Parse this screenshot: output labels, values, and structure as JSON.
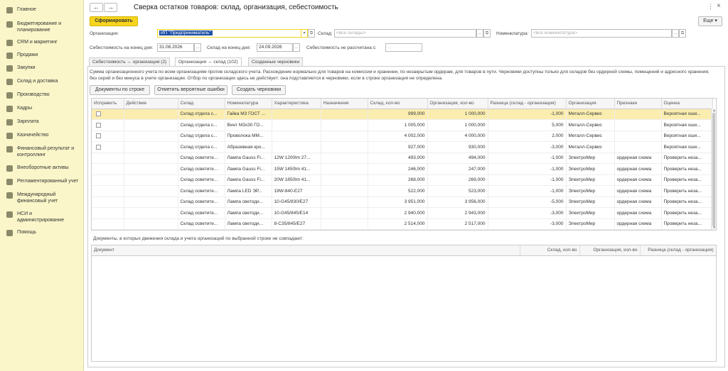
{
  "sidebar": {
    "items": [
      {
        "label": "Главное",
        "icon": "home-icon"
      },
      {
        "label": "Бюджетирование и планирование",
        "icon": "budget-icon"
      },
      {
        "label": "CRM и маркетинг",
        "icon": "crm-icon"
      },
      {
        "label": "Продажи",
        "icon": "sales-icon"
      },
      {
        "label": "Закупки",
        "icon": "purchases-icon"
      },
      {
        "label": "Склад и доставка",
        "icon": "warehouse-icon"
      },
      {
        "label": "Производство",
        "icon": "production-icon"
      },
      {
        "label": "Кадры",
        "icon": "staff-icon"
      },
      {
        "label": "Зарплата",
        "icon": "salary-icon"
      },
      {
        "label": "Казначейство",
        "icon": "treasury-icon"
      },
      {
        "label": "Финансовый результат и контроллинг",
        "icon": "finance-icon"
      },
      {
        "label": "Внеоборотные активы",
        "icon": "assets-icon"
      },
      {
        "label": "Регламентированный учет",
        "icon": "accounting-icon"
      },
      {
        "label": "Международный финансовый учет",
        "icon": "intl-icon"
      },
      {
        "label": "НСИ и администрирование",
        "icon": "admin-icon"
      },
      {
        "label": "Помощь",
        "icon": "help-icon"
      }
    ]
  },
  "header": {
    "back": "←",
    "forward": "→",
    "title": "Сверка остатков товаров: склад, организация, себестоимость",
    "more_menu": "⋮",
    "close": "×"
  },
  "toolbar": {
    "generate": "Сформировать",
    "more": "Еще ▾"
  },
  "filters": {
    "org_label": "Организация:",
    "org_value": "ИП \"Предприниматель\"",
    "warehouse_label": "Склад:",
    "warehouse_placeholder": "<все склады>",
    "nomenclature_label": "Номенклатура:",
    "nomenclature_placeholder": "<вся номенклатура>",
    "cost_end_label": "Себестоимость на конец дня:",
    "cost_end_value": "31.08.2026",
    "wh_end_label": "Склад на конец дня:",
    "wh_end_value": "24.09.2026",
    "cost_not_calc_label": "Себестоимость не рассчитана с:",
    "cost_not_calc_value": ". .",
    "drop": "...",
    "open": "⧉",
    "drop2": "▾"
  },
  "tabs": [
    {
      "label": "Себестоимость ↔ организация (2)"
    },
    {
      "label": "Организация ↔ склад (102)"
    },
    {
      "label": "Созданные черновики"
    }
  ],
  "description": "Сумма организационного учета по всем организациям против складского учета. Расхождение нормально для товаров на комиссии и хранении, по незакрытым ордерам, для товаров в пути. Черновики доступны только для складов без ордерной схемы, помещений и адресного хранения; без серий и без минуса в учете организации. Отбор по организации здесь не действует: она подставляется в черновики, если в строке организация не определена.",
  "actions": {
    "docs_by_row": "Документы по строке",
    "mark_errors": "Отметить вероятные ошибки",
    "create_drafts": "Создать черновики"
  },
  "grid": {
    "columns": [
      "Исправить",
      "Действие",
      "Склад",
      "Номенклатура",
      "Характеристика",
      "Назначение",
      "Склад, кол-во",
      "Организация, кол-во",
      "Разница (склад - организация)",
      "Организация",
      "Признаки",
      "Оценка"
    ],
    "rows": [
      {
        "check": true,
        "action": "",
        "wh": "Склад отдела с...",
        "nom": "Гайка М3 ГОСТ ...",
        "char": "",
        "purpose": "",
        "whq": "999,000",
        "orgq": "1 000,000",
        "diff": "-1,000",
        "org": "Металл-Сервис",
        "sign": "",
        "eval": "Вероятная оши..."
      },
      {
        "check": true,
        "action": "",
        "wh": "Склад отдела с...",
        "nom": "Винт М3х30 ГО...",
        "char": "",
        "purpose": "",
        "whq": "1 005,000",
        "orgq": "1 000,000",
        "diff": "5,000",
        "org": "Металл-Сервис",
        "sign": "",
        "eval": "Вероятная оши..."
      },
      {
        "check": true,
        "action": "",
        "wh": "Склад отдела с...",
        "nom": "Проволока  ММ...",
        "char": "",
        "purpose": "",
        "whq": "4 002,000",
        "orgq": "4 000,000",
        "diff": "2,000",
        "org": "Металл-Сервис",
        "sign": "",
        "eval": "Вероятная оши..."
      },
      {
        "check": true,
        "action": "",
        "wh": "Склад отдела с...",
        "nom": "Абразивная кро...",
        "char": "",
        "purpose": "",
        "whq": "927,000",
        "orgq": "930,000",
        "diff": "-3,000",
        "org": "Металл-Сервис",
        "sign": "",
        "eval": "Вероятная оши..."
      },
      {
        "check": false,
        "action": "",
        "wh": "Склад осветите...",
        "nom": "Лампа Gauss Fi...",
        "char": "12W 1200lm 27...",
        "purpose": "",
        "whq": "493,000",
        "orgq": "494,000",
        "diff": "-1,000",
        "org": "ЭлектроМир",
        "sign": "ордерная схема",
        "eval": "Проверить неза..."
      },
      {
        "check": false,
        "action": "",
        "wh": "Склад осветите...",
        "nom": "Лампа Gauss Fi...",
        "char": "15W 1450lm 41...",
        "purpose": "",
        "whq": "246,000",
        "orgq": "247,000",
        "diff": "-1,000",
        "org": "ЭлектроМир",
        "sign": "ордерная схема",
        "eval": "Проверить неза..."
      },
      {
        "check": false,
        "action": "",
        "wh": "Склад осветите...",
        "nom": "Лампа Gauss Fi...",
        "char": "20W 1850lm 41...",
        "purpose": "",
        "whq": "268,000",
        "orgq": "269,000",
        "diff": "-1,000",
        "org": "ЭлектроМир",
        "sign": "ордерная схема",
        "eval": "Проверить неза..."
      },
      {
        "check": false,
        "action": "",
        "wh": "Склад осветите...",
        "nom": "Лампа LED ЭР...",
        "char": "19W-840-E27",
        "purpose": "",
        "whq": "522,000",
        "orgq": "523,000",
        "diff": "-1,000",
        "org": "ЭлектроМир",
        "sign": "ордерная схема",
        "eval": "Проверить неза..."
      },
      {
        "check": false,
        "action": "",
        "wh": "Склад осветите...",
        "nom": "Лампа светоди...",
        "char": "10-G45/830/E27",
        "purpose": "",
        "whq": "3 951,000",
        "orgq": "3 956,000",
        "diff": "-5,000",
        "org": "ЭлектроМир",
        "sign": "ордерная схема",
        "eval": "Проверить неза..."
      },
      {
        "check": false,
        "action": "",
        "wh": "Склад осветите...",
        "nom": "Лампа светоди...",
        "char": "10-G45/845/E14",
        "purpose": "",
        "whq": "2 940,000",
        "orgq": "2 943,000",
        "diff": "-3,000",
        "org": "ЭлектроМир",
        "sign": "ордерная схема",
        "eval": "Проверить неза..."
      },
      {
        "check": false,
        "action": "",
        "wh": "Склад осветите...",
        "nom": "Лампа светоди...",
        "char": "8-C35/845/E27",
        "purpose": "",
        "whq": "2 514,000",
        "orgq": "2 517,000",
        "diff": "-3,000",
        "org": "ЭлектроМир",
        "sign": "ордерная схема",
        "eval": "Проверить неза..."
      }
    ]
  },
  "docs": {
    "caption": "Документы, в которых движения склада и учета организаций по выбранной строке не совпадают:",
    "columns": [
      "Документ",
      "Склад, кол-во",
      "Организация, кол-во",
      "Разница (склад - организация)"
    ]
  },
  "scroll_up": "▲",
  "scroll_down": "▼",
  "colors": {
    "accent": "#f7d51c",
    "sidebar": "#fbf6c9",
    "selected_row": "#fbedb0",
    "highlight": "#1e4fa3"
  }
}
